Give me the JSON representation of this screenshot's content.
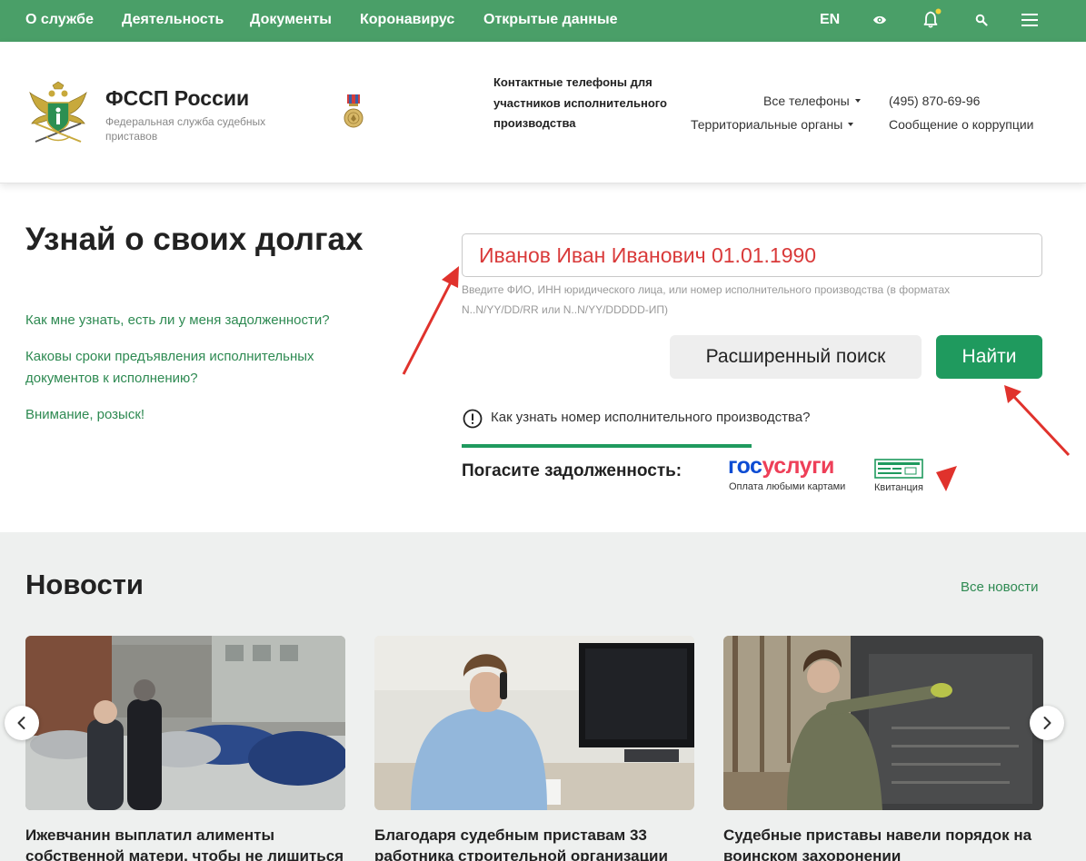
{
  "nav": {
    "items": [
      "О службе",
      "Деятельность",
      "Документы",
      "Коронавирус",
      "Открытые данные"
    ],
    "lang": "EN",
    "icons": [
      "eye-icon",
      "bell-icon",
      "search-icon",
      "menu-icon"
    ],
    "bar_color": "#4a9f68",
    "notification_dot_color": "#f2d33a"
  },
  "header": {
    "brand_title": "ФССП России",
    "brand_subtitle": "Федеральная служба судебных приставов",
    "contacts_title": "Контактные телефоны для участников исполнительного производства",
    "all_phones": "Все телефоны",
    "territorial": "Территориальные органы",
    "phone": "(495) 870-69-96",
    "corruption": "Сообщение о коррупции"
  },
  "search": {
    "heading": "Узнай о своих долгах",
    "faq": [
      "Как мне узнать, есть ли у меня задолженности?",
      "Каковы сроки предъявления исполнительных документов к исполнению?",
      "Внимание, розыск!"
    ],
    "query": "Иванов Иван Иванович 01.01.1990",
    "hint": "Введите ФИО, ИНН юридического лица, или номер исполнительного производства (в форматах N..N/YY/DD/RR или N..N/YY/DDDDD-ИП)",
    "advanced_label": "Расширенный поиск",
    "find_label": "Найти",
    "how_to_know": "Как узнать номер исполнительного производства?"
  },
  "payment": {
    "title": "Погасите задолженность:",
    "gosuslugi_part1": "гос",
    "gosuslugi_part2": "услуги",
    "gosuslugi_caption": "Оплата любыми картами",
    "receipt_caption": "Квитанция"
  },
  "news": {
    "title": "Новости",
    "all_news": "Все новости",
    "cards": [
      {
        "headline": "Ижевчанин выплатил алименты собственной матери, чтобы не лишиться"
      },
      {
        "headline": "Благодаря судебным приставам 33 работника строительной организации"
      },
      {
        "headline": "Судебные приставы навели порядок на воинском захоронении"
      }
    ]
  },
  "colors": {
    "accent_green": "#1f9a5e",
    "link_green": "#2e8a52",
    "input_text_red": "#d93a3a",
    "annotation_arrow_red": "#e0322c"
  }
}
